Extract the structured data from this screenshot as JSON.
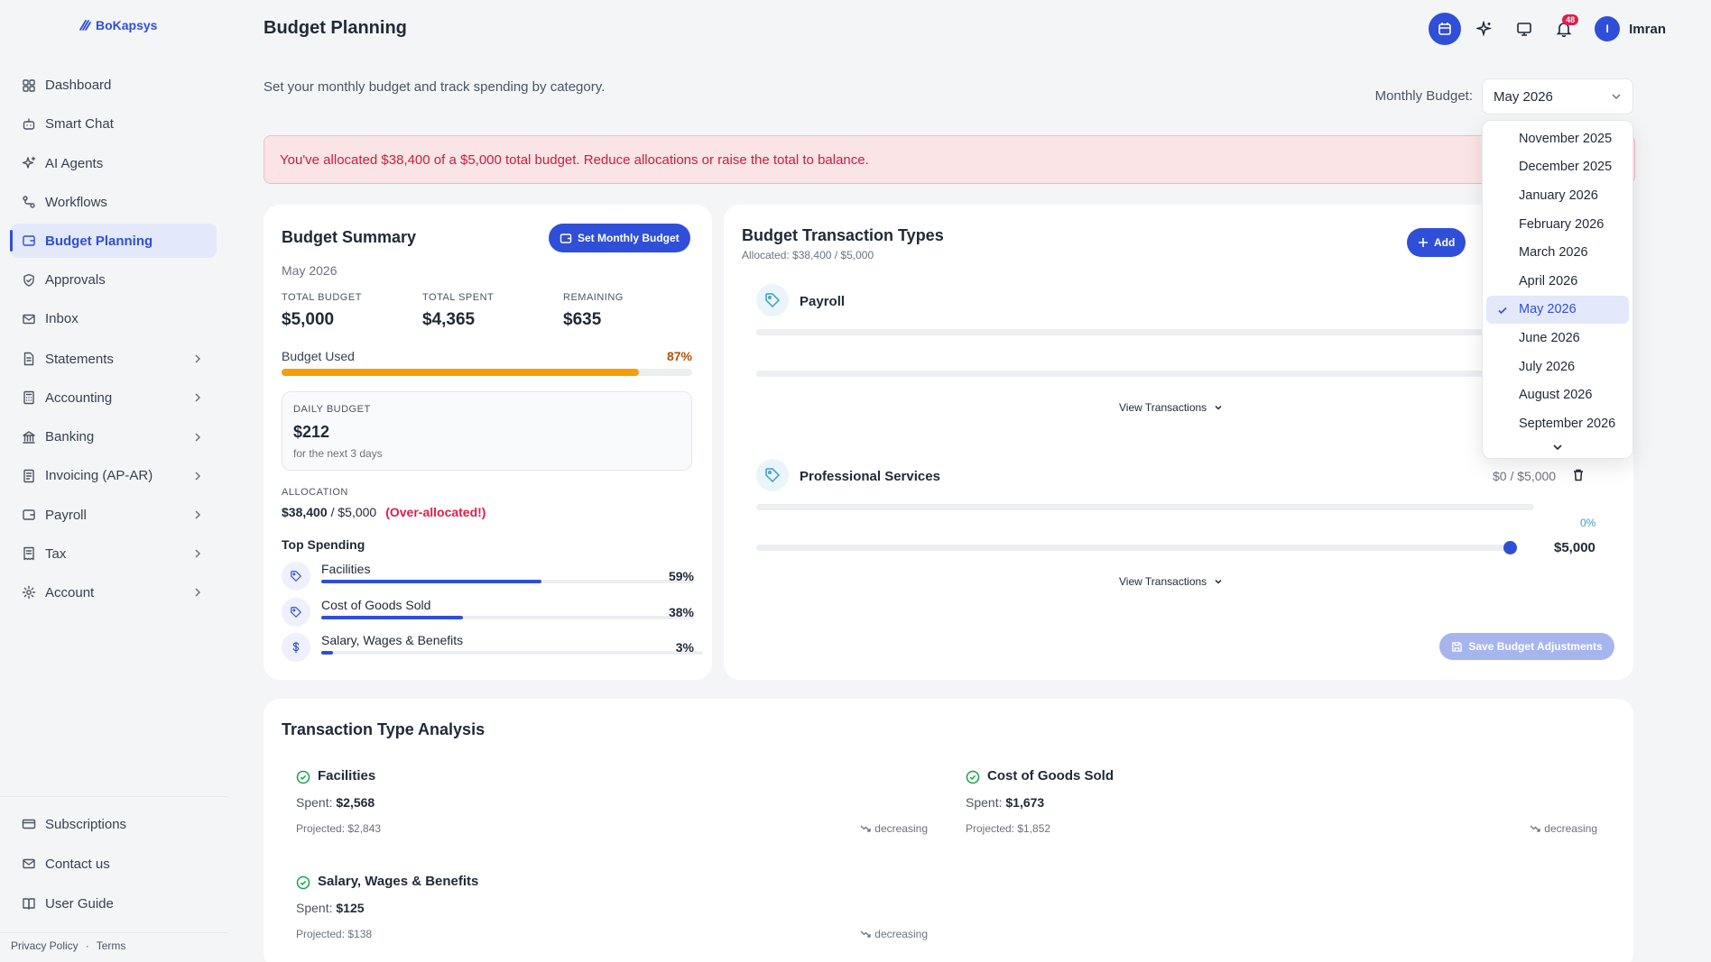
{
  "brand": {
    "name": "BoKapsys"
  },
  "sidebar": {
    "items": [
      {
        "label": "Dashboard",
        "icon": "grid-icon"
      },
      {
        "label": "Smart Chat",
        "icon": "robot-icon"
      },
      {
        "label": "AI Agents",
        "icon": "sparkles-icon"
      },
      {
        "label": "Workflows",
        "icon": "workflow-icon"
      },
      {
        "label": "Budget Planning",
        "icon": "wallet-icon",
        "active": true
      },
      {
        "label": "Approvals",
        "icon": "shield-check-icon"
      },
      {
        "label": "Inbox",
        "icon": "mail-icon"
      },
      {
        "label": "Statements",
        "icon": "document-icon",
        "has_children": true
      },
      {
        "label": "Accounting",
        "icon": "calculator-icon",
        "has_children": true
      },
      {
        "label": "Banking",
        "icon": "bank-icon",
        "has_children": true
      },
      {
        "label": "Invoicing (AP-AR)",
        "icon": "invoice-icon",
        "has_children": true
      },
      {
        "label": "Payroll",
        "icon": "wallet-icon",
        "has_children": true
      },
      {
        "label": "Tax",
        "icon": "receipt-icon",
        "has_children": true
      },
      {
        "label": "Account",
        "icon": "gear-icon",
        "has_children": true
      }
    ],
    "bottom_items": [
      {
        "label": "Subscriptions",
        "icon": "card-icon"
      },
      {
        "label": "Contact us",
        "icon": "mail-icon"
      },
      {
        "label": "User Guide",
        "icon": "book-icon"
      }
    ],
    "footer": {
      "privacy": "Privacy Policy",
      "sep": "·",
      "terms": "Terms"
    }
  },
  "header": {
    "title": "Budget Planning",
    "subtitle": "Set your monthly budget and track spending by category.",
    "notifications_count": "48",
    "user_initial": "I",
    "user_name": "Imran",
    "monthly_budget_label": "Monthly Budget:",
    "monthly_budget_value": "May 2026"
  },
  "alert": {
    "text": "You've allocated $38,400 of a $5,000 total budget. Reduce allocations or raise the total to balance."
  },
  "summary": {
    "title": "Budget Summary",
    "set_button": "Set Monthly Budget",
    "month": "May 2026",
    "total_budget_label": "TOTAL BUDGET",
    "total_budget": "$5,000",
    "total_spent_label": "TOTAL SPENT",
    "total_spent": "$4,365",
    "remaining_label": "REMAINING",
    "remaining": "$635",
    "used_label": "Budget Used",
    "used_pct": "87%",
    "used_fraction": 0.87,
    "daily_label": "DAILY BUDGET",
    "daily_value": "$212",
    "daily_note": "for the next 3 days",
    "allocation_label": "ALLOCATION",
    "allocation_value": "$38,400",
    "allocation_total": "/ $5,000",
    "allocation_warning": "(Over-allocated!)",
    "top_spending_label": "Top Spending",
    "top_spending": [
      {
        "name": "Facilities",
        "pct": "59%",
        "fraction": 0.59,
        "icon": "tag-icon"
      },
      {
        "name": "Cost of Goods Sold",
        "pct": "38%",
        "fraction": 0.38,
        "icon": "tag-icon"
      },
      {
        "name": "Salary, Wages & Benefits",
        "pct": "3%",
        "fraction": 0.03,
        "icon": "dollar-icon"
      }
    ]
  },
  "types": {
    "title": "Budget Transaction Types",
    "allocated": "Allocated: $38,400 / $5,000",
    "add_button": "Add",
    "items": [
      {
        "name": "Payroll",
        "icon": "tag-icon",
        "view": "View Transactions"
      },
      {
        "name": "Professional Services",
        "icon": "tag-icon",
        "amount": "$0 / $5,000",
        "pct": "0%",
        "slider_value": "$5,000",
        "slider_fraction": 1.0,
        "view": "View Transactions"
      }
    ],
    "save_button": "Save Budget Adjustments"
  },
  "analysis": {
    "title": "Transaction Type Analysis",
    "items": [
      {
        "name": "Facilities",
        "spent_label": "Spent:",
        "spent": "$2,568",
        "projected": "Projected: $2,843",
        "trend": "decreasing"
      },
      {
        "name": "Cost of Goods Sold",
        "spent_label": "Spent:",
        "spent": "$1,673",
        "projected": "Projected: $1,852",
        "trend": "decreasing"
      },
      {
        "name": "Salary, Wages & Benefits",
        "spent_label": "Spent:",
        "spent": "$125",
        "projected": "Projected: $138",
        "trend": "decreasing"
      }
    ]
  },
  "dropdown": {
    "options": [
      "November 2025",
      "December 2025",
      "January 2026",
      "February 2026",
      "March 2026",
      "April 2026",
      "May 2026",
      "June 2026",
      "July 2026",
      "August 2026",
      "September 2026"
    ],
    "selected": "May 2026"
  },
  "colors": {
    "accent": "#2f4fd8",
    "progress": "#f59e0b",
    "danger": "#e11d48",
    "success": "#16a34a"
  }
}
